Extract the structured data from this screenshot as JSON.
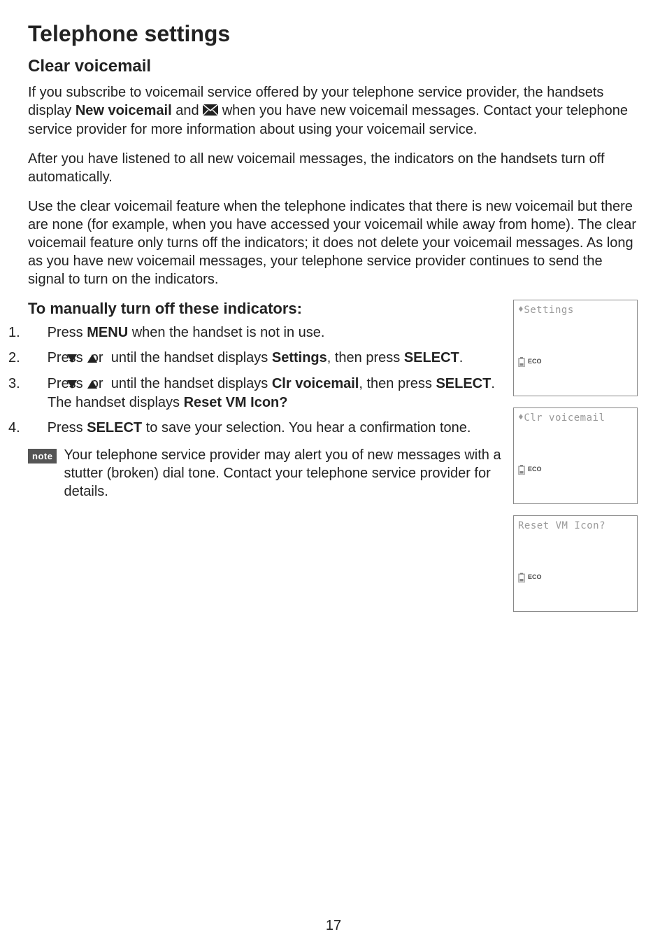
{
  "heading": "Telephone settings",
  "section_title": "Clear voicemail",
  "para1_pre": "If you subscribe to voicemail service offered by your telephone service provider, the handsets display ",
  "para1_bold": "New voicemail",
  "para1_mid": " and ",
  "para1_post": " when you have new voicemail messages. Contact your telephone service provider for more information about using your voicemail service.",
  "para2": "After you have listened to all new voicemail messages, the indicators on the handsets turn off automatically.",
  "para3": "Use the clear voicemail feature when the telephone indicates that there is new voicemail but there are none (for example, when you have accessed your voicemail while away from home). The clear voicemail feature only turns off the indicators; it does not delete your voicemail messages. As long as you have new voicemail messages, your telephone service provider continues to send the signal to turn on the indicators.",
  "sub_heading": "To manually turn off these indicators:",
  "steps": {
    "s1_pre": "Press ",
    "s1_b1": "MENU",
    "s1_post": " when the handset is not in use.",
    "s2_pre": "Press ",
    "s2_mid": " or ",
    "s2_mid2": " until the handset displays ",
    "s2_b1": "Settings",
    "s2_mid3": ", then press ",
    "s2_b2": "SELECT",
    "s2_post": ".",
    "s3_pre": "Press ",
    "s3_mid": " or ",
    "s3_mid2": " until the handset displays ",
    "s3_b1": "Clr voicemail",
    "s3_mid3": ", then press ",
    "s3_b2": "SELECT",
    "s3_mid4": ". The handset displays ",
    "s3_b3": "Reset VM Icon?",
    "s4_pre": "Press ",
    "s4_b1": "SELECT",
    "s4_post": " to save your selection. You hear a confirmation tone."
  },
  "note_label": "note",
  "note_text": "Your telephone service provider may alert you of new messages with a stutter (broken) dial tone. Contact your telephone service provider for details.",
  "screens": {
    "s1_line": "Settings",
    "s2_line": "Clr voicemail",
    "s3_line": "Reset VM Icon?",
    "eco": "ECO"
  },
  "page_number": "17"
}
